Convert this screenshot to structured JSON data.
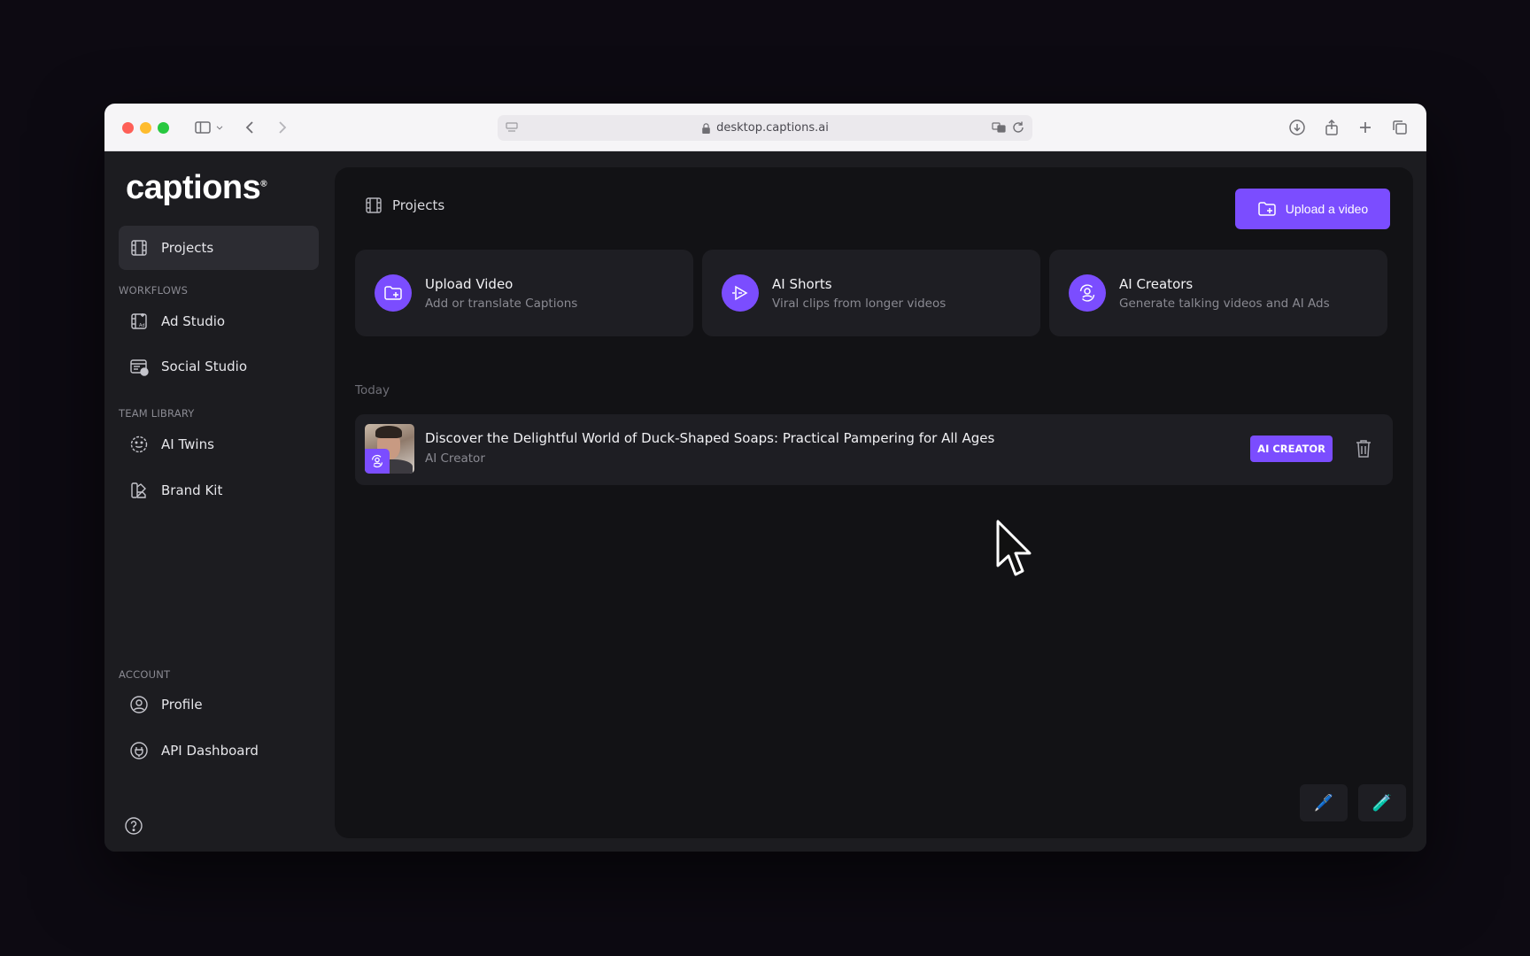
{
  "browser": {
    "url": "desktop.captions.ai"
  },
  "sidebar": {
    "logo": "captions",
    "projects_label": "Projects",
    "workflows_label": "WORKFLOWS",
    "workflow_items": [
      {
        "label": "Ad Studio",
        "icon": "ad-studio-icon"
      },
      {
        "label": "Social Studio",
        "icon": "social-studio-icon"
      }
    ],
    "team_library_label": "TEAM LIBRARY",
    "team_items": [
      {
        "label": "AI Twins",
        "icon": "smiley-face-icon"
      },
      {
        "label": "Brand Kit",
        "icon": "brand-kit-icon"
      }
    ],
    "account_label": "ACCOUNT",
    "account_items": [
      {
        "label": "Profile",
        "icon": "user-circle-icon"
      },
      {
        "label": "API Dashboard",
        "icon": "plug-icon"
      }
    ]
  },
  "main": {
    "header_title": "Projects",
    "upload_button": "Upload a video",
    "cards": [
      {
        "title": "Upload Video",
        "subtitle": "Add or translate Captions"
      },
      {
        "title": "AI Shorts",
        "subtitle": "Viral clips from longer videos"
      },
      {
        "title": "AI Creators",
        "subtitle": "Generate talking videos and AI Ads"
      }
    ],
    "date_group": "Today",
    "project": {
      "title": "Discover the Delightful World of Duck-Shaped Soaps: Practical Pampering for All Ages",
      "subtitle": "AI Creator",
      "badge": "AI CREATOR"
    },
    "bottom_buttons": [
      "🖊️",
      "🧪"
    ]
  },
  "colors": {
    "accent": "#7b4dff",
    "panel": "#121215",
    "sidebar": "#1c1c20"
  }
}
